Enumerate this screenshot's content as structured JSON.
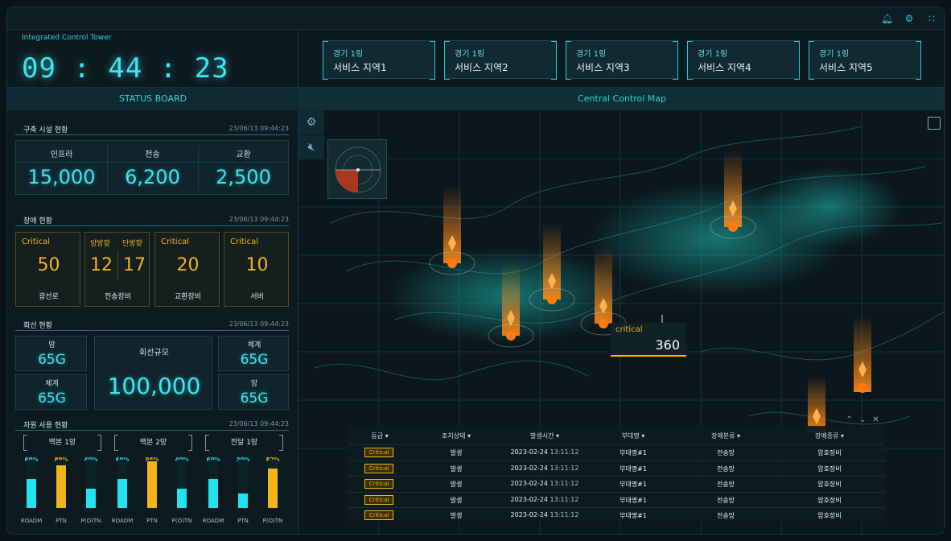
{
  "app_title": "Integrated Control Tower",
  "clock": "09 : 44 : 23",
  "tabs": [
    {
      "ring": "경기 1링",
      "area": "서비스 지역1"
    },
    {
      "ring": "경기 1링",
      "area": "서비스 지역2"
    },
    {
      "ring": "경기 1링",
      "area": "서비스 지역3"
    },
    {
      "ring": "경기 1링",
      "area": "서비스 지역4"
    },
    {
      "ring": "경기 1링",
      "area": "서비스 지역5"
    }
  ],
  "status_board_title": "STATUS BOARD",
  "map_title": "Central Control Map",
  "facilities": {
    "title": "구축 시설 현황",
    "date": "23/06/13",
    "time": "09:44:23",
    "items": [
      {
        "label": "인프라",
        "value": "15,000"
      },
      {
        "label": "전송",
        "value": "6,200"
      },
      {
        "label": "교환",
        "value": "2,500"
      }
    ]
  },
  "faults": {
    "title": "장애 현황",
    "date": "23/06/13",
    "time": "09:44:23",
    "items": [
      {
        "head": "Critical",
        "value": "50",
        "name": "광선로"
      },
      {
        "head_a": "양방향",
        "head_b": "단방향",
        "value_a": "12",
        "value_b": "17",
        "name": "전송장비"
      },
      {
        "head": "Critical",
        "value": "20",
        "name": "교환장비"
      },
      {
        "head": "Critical",
        "value": "10",
        "name": "서버"
      }
    ]
  },
  "lines": {
    "title": "회선 현황",
    "date": "23/06/13",
    "time": "09:44:23",
    "left": [
      {
        "label": "망",
        "value": "65G"
      },
      {
        "label": "체계",
        "value": "65G"
      }
    ],
    "center": {
      "label": "회선규모",
      "value": "100,000"
    },
    "right": [
      {
        "label": "체계",
        "value": "65G"
      },
      {
        "label": "망",
        "value": "65G"
      }
    ]
  },
  "resources": {
    "title": "자원 사용 현황",
    "date": "23/06/13",
    "time": "09:44:23",
    "groups": [
      "백본 1망",
      "백본 2망",
      "전달 1망"
    ],
    "bars": [
      {
        "name": "ROADM",
        "pct": 60,
        "label": "60%",
        "color": "#22e4f0"
      },
      {
        "name": "PTN",
        "pct": 89,
        "label": "89%",
        "color": "#f5b417"
      },
      {
        "name": "P(O)TN",
        "pct": 40,
        "label": "40%",
        "color": "#22e4f0"
      },
      {
        "name": "ROADM",
        "pct": 60,
        "label": "60%",
        "color": "#22e4f0"
      },
      {
        "name": "PTN",
        "pct": 96,
        "label": "96%",
        "color": "#f5b417"
      },
      {
        "name": "P(O)TN",
        "pct": 40,
        "label": "40%",
        "color": "#22e4f0"
      },
      {
        "name": "ROADM",
        "pct": 60,
        "label": "60%",
        "color": "#22e4f0"
      },
      {
        "name": "PTN",
        "pct": 30,
        "label": "30%",
        "color": "#22e4f0"
      },
      {
        "name": "P(O)TN",
        "pct": 82,
        "label": "82%",
        "color": "#f5b417"
      }
    ]
  },
  "popup": {
    "label": "critical",
    "value": "360"
  },
  "table": {
    "headers": [
      "등급 ▾",
      "조치상태 ▾",
      "발생시간 ▾",
      "부대명 ▾",
      "장애분류 ▾",
      "장애종류 ▾"
    ],
    "rows": [
      {
        "grade": "Critical",
        "state": "발생",
        "date": "2023-02-24",
        "time": "13:11:12",
        "unit": "부대명#1",
        "class": "전송망",
        "kind": "암호장비"
      },
      {
        "grade": "Critical",
        "state": "발생",
        "date": "2023-02-24",
        "time": "13:11:12",
        "unit": "부대명#1",
        "class": "전송망",
        "kind": "암호장비"
      },
      {
        "grade": "Critical",
        "state": "발생",
        "date": "2023-02-24",
        "time": "13:11:12",
        "unit": "부대명#1",
        "class": "전송망",
        "kind": "암호장비"
      },
      {
        "grade": "Critical",
        "state": "발생",
        "date": "2023-02-24",
        "time": "13:11:12",
        "unit": "부대명#1",
        "class": "전송망",
        "kind": "암호장비"
      },
      {
        "grade": "Critical",
        "state": "발생",
        "date": "2023-02-24",
        "time": "13:11:12",
        "unit": "부대명#1",
        "class": "전송망",
        "kind": "암호장비"
      }
    ]
  }
}
